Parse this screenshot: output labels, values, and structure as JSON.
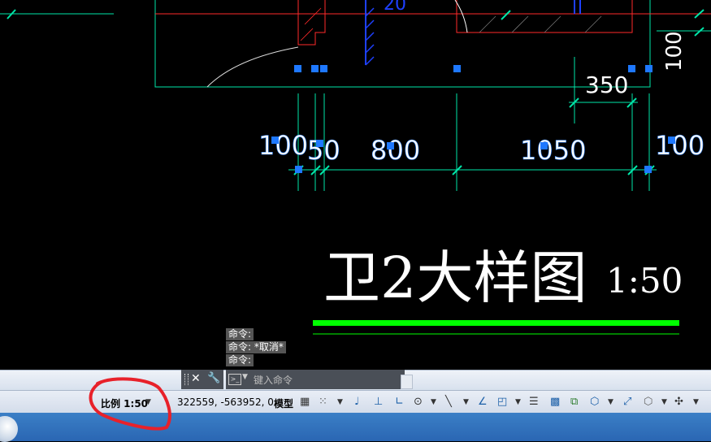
{
  "drawing": {
    "dimensions": {
      "d100": "100",
      "d350": "350",
      "d100_left": "100",
      "d50": "50",
      "d800": "800",
      "d1050": "1050",
      "d100_right": "100",
      "d20": "20"
    },
    "title": "卫2大样图",
    "scale": "1:50"
  },
  "command": {
    "history": [
      "命令:",
      "命令: *取消*",
      "命令:"
    ],
    "placeholder": "键入命令"
  },
  "statusbar": {
    "scale_label": "比例 1:50",
    "coordinates": "322559, -563952, 0",
    "space": "模型"
  },
  "colors": {
    "background": "#000000",
    "dimension_line": "#00e6a8",
    "dimension_text": "#ffffff",
    "wall_red": "#ff2a2a",
    "grip_blue": "#1e78ff",
    "title_underline": "#00ff00",
    "annotation_circle": "#e8212a"
  },
  "icons": [
    "close-icon",
    "wrench-icon",
    "command-prompt-icon",
    "grid-icon",
    "snap-icon",
    "ortho-icon",
    "polar-icon",
    "osnap-icon",
    "otrack-icon",
    "ducs-icon",
    "lineweight-icon",
    "transparency-icon",
    "selection-cycling-icon",
    "3d-osnap-icon",
    "ucs-icon",
    "view-cube-icon",
    "gizmo-icon"
  ]
}
